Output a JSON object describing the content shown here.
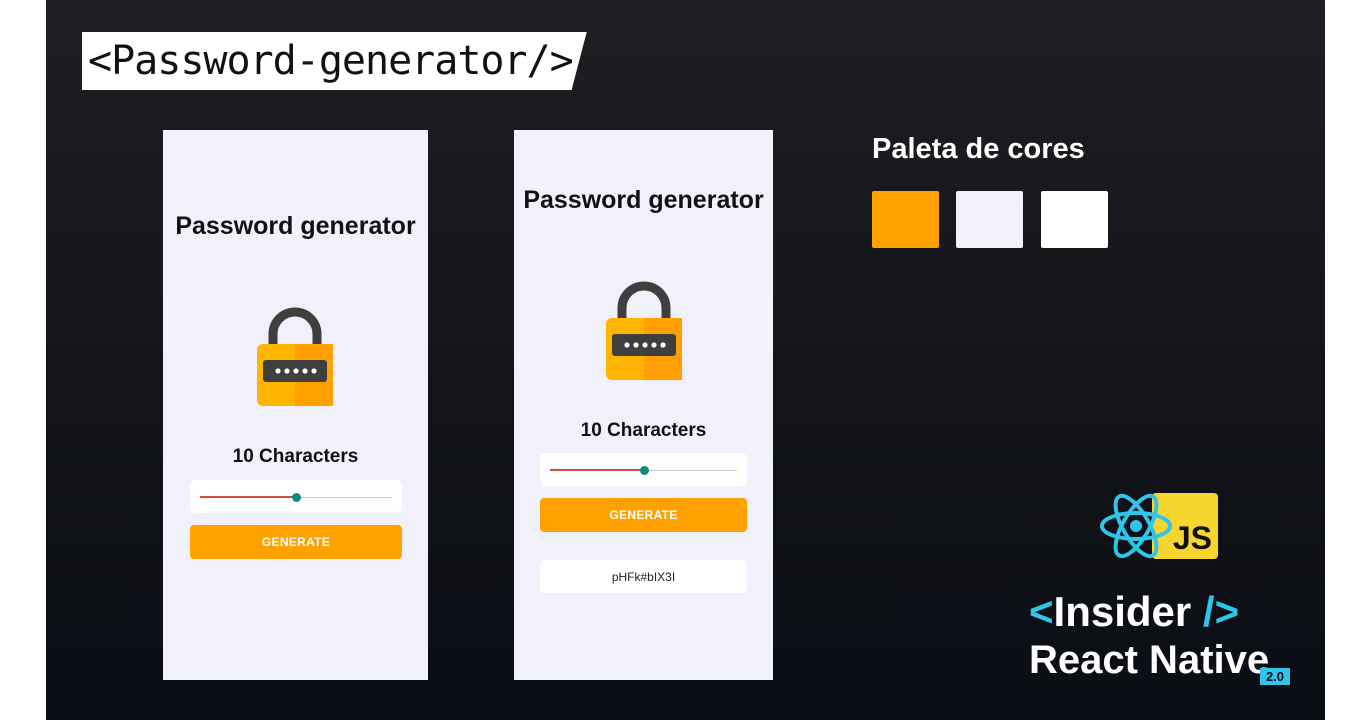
{
  "slide_title": "<Password-generator/>",
  "colors": {
    "accent": "#ffa200",
    "background_light": "#f1f1fb",
    "white": "#ffffff",
    "slider_active": "#d64b3c",
    "slider_thumb": "#118a7e",
    "brand_cyan": "#2ec5e8",
    "js_yellow": "#f7d530"
  },
  "mockup_1": {
    "title": "Password generator",
    "lock_icon": "padlock-icon",
    "length_label": "10 Characters",
    "slider_value": 0.5,
    "button_label": "GENERATE"
  },
  "mockup_2": {
    "title": "Password generator",
    "lock_icon": "padlock-icon",
    "length_label": "10 Characters",
    "slider_value": 0.5,
    "button_label": "GENERATE",
    "generated_password": "pHFk#bIX3I"
  },
  "palette": {
    "title": "Paleta de cores",
    "swatches": [
      "#ffa200",
      "#f1f1fb",
      "#ffffff"
    ]
  },
  "brand": {
    "react_icon": "react-atom-icon",
    "js_badge": "JS",
    "insider_open": "<",
    "insider_word": "Insider",
    "insider_close": "/>",
    "product": "React Native",
    "version": "2.0"
  }
}
